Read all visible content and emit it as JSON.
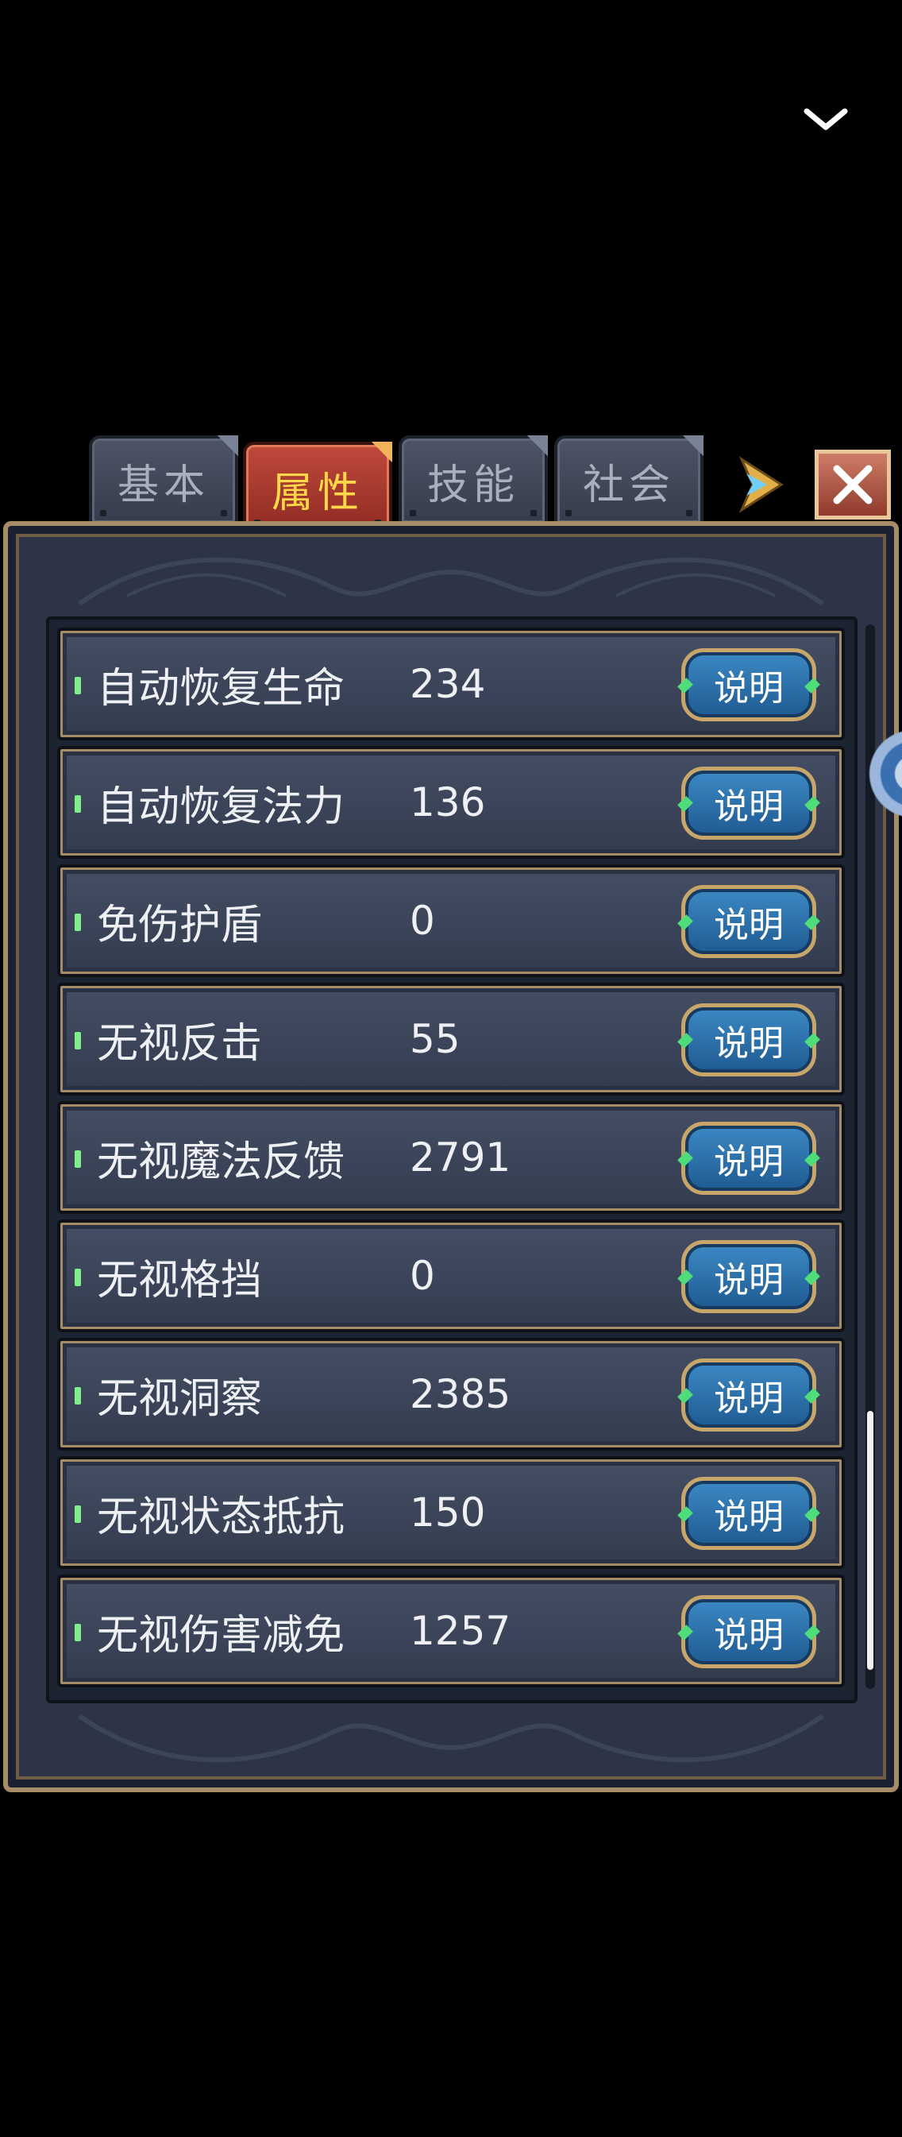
{
  "tabs": [
    {
      "label": "基本"
    },
    {
      "label": "属性"
    },
    {
      "label": "技能"
    },
    {
      "label": "社会"
    }
  ],
  "active_tab": "属性",
  "attributes": [
    {
      "label": "自动恢复生命",
      "value": "234",
      "button": "说明"
    },
    {
      "label": "自动恢复法力",
      "value": "136",
      "button": "说明"
    },
    {
      "label": "免伤护盾",
      "value": "0",
      "button": "说明"
    },
    {
      "label": "无视反击",
      "value": "55",
      "button": "说明"
    },
    {
      "label": "无视魔法反馈",
      "value": "2791",
      "button": "说明"
    },
    {
      "label": "无视格挡",
      "value": "0",
      "button": "说明"
    },
    {
      "label": "无视洞察",
      "value": "2385",
      "button": "说明"
    },
    {
      "label": "无视状态抵抗",
      "value": "150",
      "button": "说明"
    },
    {
      "label": "无视伤害减免",
      "value": "1257",
      "button": "说明"
    }
  ],
  "icons": {
    "collapse": "chevron-down-icon",
    "next_tab": "arrow-right-icon",
    "close": "close-icon"
  },
  "colors": {
    "active_tab_text": "#ffd84a",
    "active_tab_bg": "#c0493b",
    "button_bg": "#2b74b0",
    "frame_gold": "#a58d68"
  }
}
